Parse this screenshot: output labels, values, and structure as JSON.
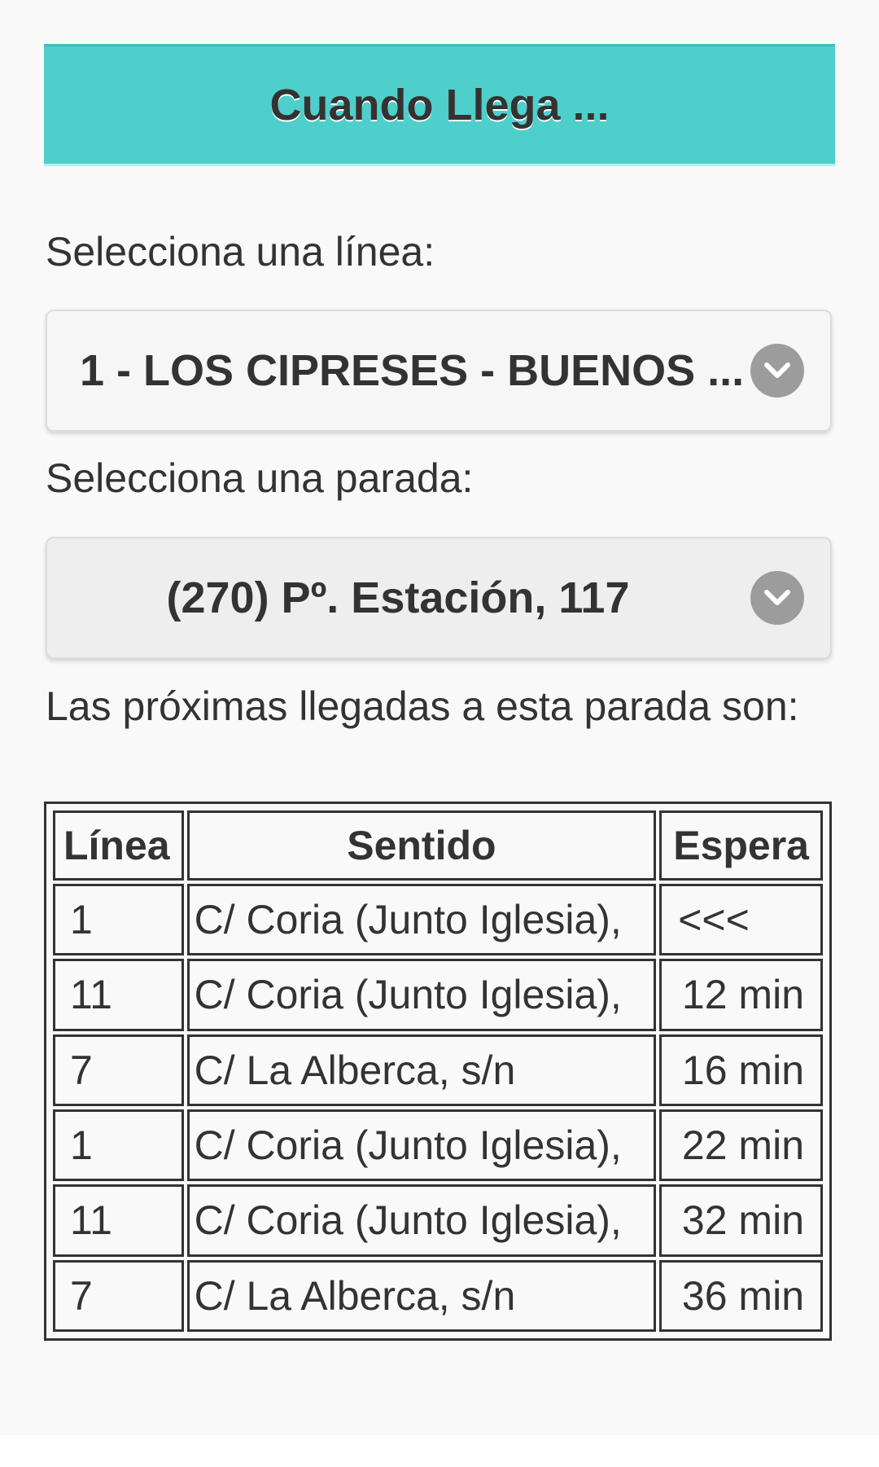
{
  "header": {
    "title": "Cuando Llega ..."
  },
  "line_select": {
    "label": "Selecciona una línea:",
    "value": "1 - LOS CIPRESES - BUENOS ..."
  },
  "stop_select": {
    "label": "Selecciona una parada:",
    "value": "(270) Pº. Estación, 117"
  },
  "arrivals": {
    "label": "Las próximas llegadas a esta parada son:",
    "columns": [
      "Línea",
      "Sentido",
      "Espera"
    ],
    "rows": [
      [
        "1",
        "C/ Coria (Junto Iglesia),",
        "<<<"
      ],
      [
        "11",
        "C/ Coria (Junto Iglesia),",
        "12 min"
      ],
      [
        "7",
        "C/ La Alberca, s/n",
        "16 min"
      ],
      [
        "1",
        "C/ Coria (Junto Iglesia),",
        "22 min"
      ],
      [
        "11",
        "C/ Coria (Junto Iglesia),",
        "32 min"
      ],
      [
        "7",
        "C/ La Alberca, s/n",
        "36 min"
      ]
    ]
  },
  "icons": {
    "select_chevron": "chevron-down-icon"
  },
  "colors": {
    "header_bg": "#4ecfcb",
    "chevron_bg": "#9c9c9c"
  }
}
